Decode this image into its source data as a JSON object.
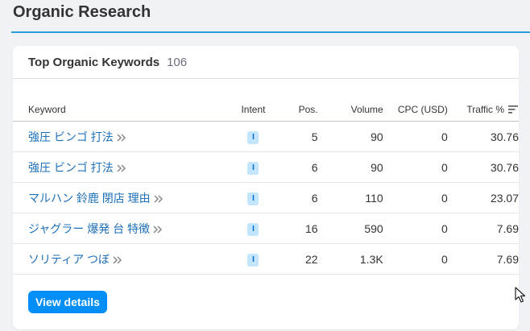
{
  "page_title": "Organic Research",
  "card": {
    "title": "Top Organic Keywords",
    "count": "106"
  },
  "table": {
    "headers": {
      "keyword": "Keyword",
      "intent": "Intent",
      "pos": "Pos.",
      "volume": "Volume",
      "cpc": "CPC (USD)",
      "traffic": "Traffic %"
    },
    "rows": [
      {
        "keyword": "強圧 ビンゴ 打法",
        "intent": "I",
        "pos": "5",
        "volume": "90",
        "cpc": "0",
        "traffic": "30.76"
      },
      {
        "keyword": "強圧 ビンゴ 打法",
        "intent": "I",
        "pos": "6",
        "volume": "90",
        "cpc": "0",
        "traffic": "30.76"
      },
      {
        "keyword": "マルハン 鈴鹿 閉店 理由",
        "intent": "I",
        "pos": "6",
        "volume": "110",
        "cpc": "0",
        "traffic": "23.07"
      },
      {
        "keyword": "ジャグラー 爆発 台 特徴",
        "intent": "I",
        "pos": "16",
        "volume": "590",
        "cpc": "0",
        "traffic": "7.69"
      },
      {
        "keyword": "ソリティア つぼ",
        "intent": "I",
        "pos": "22",
        "volume": "1.3K",
        "cpc": "0",
        "traffic": "7.69"
      }
    ]
  },
  "view_details_label": "View details",
  "icons": {
    "row_chevron": "double-chevron-right-icon",
    "sort": "sort-descending-icon",
    "cursor": "mouse-pointer-icon"
  },
  "colors": {
    "accent": "#2b9fd8",
    "link": "#1d6fb8",
    "button": "#008ff8",
    "intent_bg": "#c4e5fe",
    "intent_fg": "#006dca"
  }
}
